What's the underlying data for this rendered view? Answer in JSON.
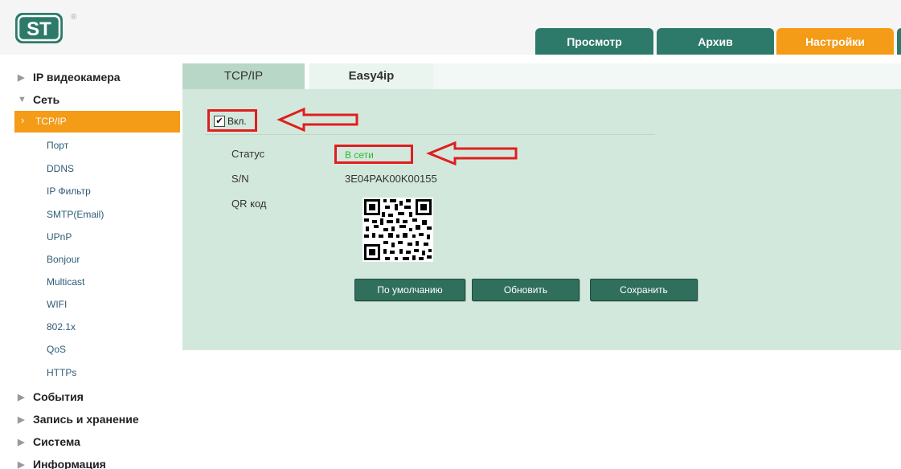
{
  "header": {
    "logo_text": "ST",
    "logo_mark": "®",
    "tabs": [
      {
        "label": "Просмотр"
      },
      {
        "label": "Архив"
      },
      {
        "label": "Настройки"
      }
    ]
  },
  "sidebar": {
    "sections": [
      {
        "label": "IP видеокамера",
        "arrow": "▶"
      },
      {
        "label": "Сеть",
        "arrow": "▼"
      },
      {
        "label": "События",
        "arrow": "▶"
      },
      {
        "label": "Запись и хранение",
        "arrow": "▶"
      },
      {
        "label": "Система",
        "arrow": "▶"
      },
      {
        "label": "Информация",
        "arrow": "▶"
      }
    ],
    "network_items": [
      {
        "label": "TCP/IP",
        "arrow": "›"
      },
      {
        "label": "Порт"
      },
      {
        "label": "DDNS"
      },
      {
        "label": "IP Фильтр"
      },
      {
        "label": "SMTP(Email)"
      },
      {
        "label": "UPnP"
      },
      {
        "label": "Bonjour"
      },
      {
        "label": "Multicast"
      },
      {
        "label": "WIFI"
      },
      {
        "label": "802.1x"
      },
      {
        "label": "QoS"
      },
      {
        "label": "HTTPs"
      }
    ]
  },
  "content": {
    "tabs": [
      {
        "label": "TCP/IP"
      },
      {
        "label": "Easy4ip"
      }
    ],
    "enable": {
      "label": "Вкл.",
      "checked": true
    },
    "status": {
      "label": "Статус",
      "value": "В сети"
    },
    "sn": {
      "label": "S/N",
      "value": "3E04PAK00K00155"
    },
    "qr": {
      "label": "QR код"
    },
    "buttons": {
      "default": "По умолчанию",
      "refresh": "Обновить",
      "save": "Сохранить"
    }
  },
  "colors": {
    "accent_orange": "#f49b18",
    "tab_green": "#2d7a6a",
    "panel_bg": "#d3e8dd",
    "annotation_red": "#e01e1e",
    "status_green": "#2db82d"
  }
}
